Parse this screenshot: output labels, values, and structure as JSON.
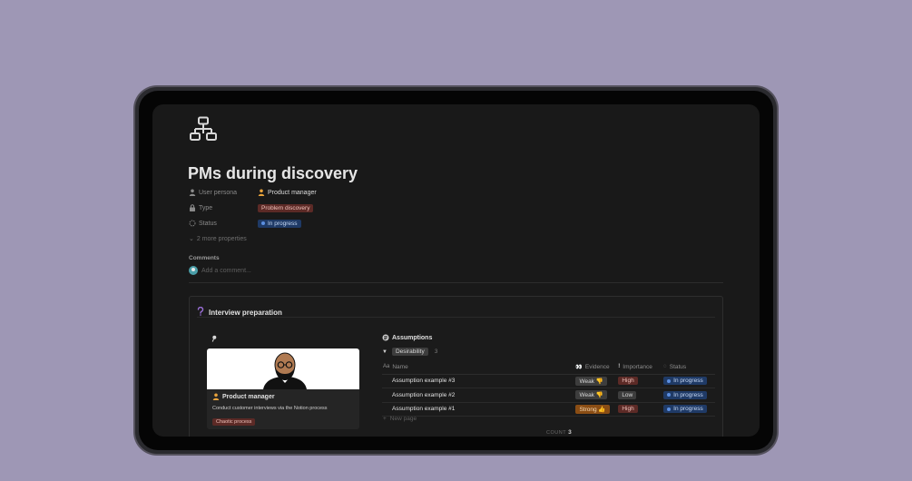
{
  "page": {
    "title": "PMs during discovery",
    "icon": "org-chart-icon"
  },
  "properties": [
    {
      "name": "User persona",
      "icon": "person-icon",
      "value": "Product manager",
      "value_icon": "person-orange-icon"
    },
    {
      "name": "Type",
      "icon": "lock-icon",
      "value": "Problem discovery",
      "tag_color": "#5c2a26"
    },
    {
      "name": "Status",
      "icon": "status-circle-icon",
      "value": "In progress",
      "tag_color": "#1f3a66"
    }
  ],
  "more_properties": "2 more properties",
  "comments": {
    "label": "Comments",
    "placeholder": "Add a comment..."
  },
  "callout": {
    "title": "Interview preparation",
    "icon": "question-mark-icon",
    "pin_icon": "pushpin-icon",
    "card": {
      "title": "Product manager",
      "description": "Conduct customer interviews via the Notion process",
      "tag": "Chaotic process"
    },
    "assumptions": {
      "title": "Assumptions",
      "group": {
        "label": "Desirability",
        "count": "3"
      },
      "columns": {
        "name": "Name",
        "name_prefix": "Aa",
        "evidence": "Evidence",
        "importance": "Importance",
        "status": "Status"
      },
      "rows": [
        {
          "name": "Assumption example #3",
          "evidence": "Weak 👎",
          "evidence_color": "#3d3d3d",
          "importance": "High",
          "importance_color": "#5c2a26",
          "status": "In progress"
        },
        {
          "name": "Assumption example #2",
          "evidence": "Weak 👎",
          "evidence_color": "#3d3d3d",
          "importance": "Low",
          "importance_color": "#3d3d3d",
          "status": "In progress"
        },
        {
          "name": "Assumption example #1",
          "evidence": "Strong 👍",
          "evidence_color": "#8a4d14",
          "importance": "High",
          "importance_color": "#5c2a26",
          "status": "In progress"
        }
      ],
      "new_page": "New page",
      "count_label": "COUNT",
      "count_value": "3"
    }
  },
  "colors": {
    "background": "#9e97b5",
    "screen": "#191919",
    "accent_blue": "#1f3a66",
    "accent_red": "#5c2a26"
  }
}
